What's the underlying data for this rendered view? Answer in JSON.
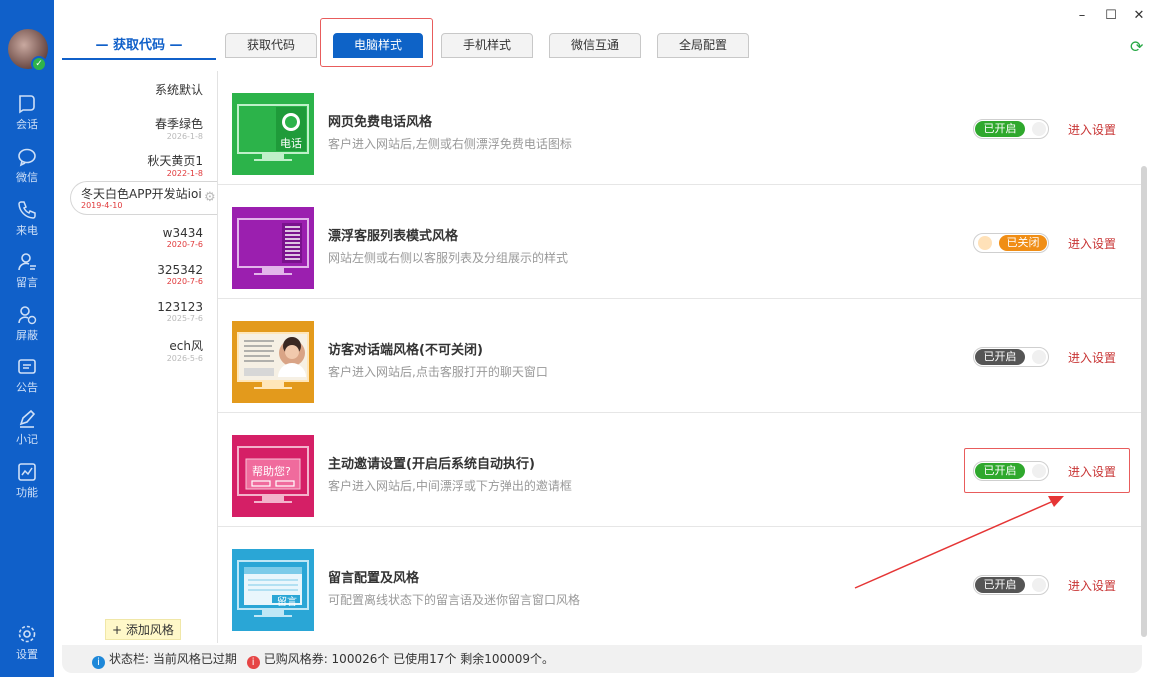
{
  "rail": {
    "items": [
      {
        "label": "会话",
        "icon": "chat-bubble-icon"
      },
      {
        "label": "微信",
        "icon": "wechat-icon"
      },
      {
        "label": "来电",
        "icon": "phone-icon"
      },
      {
        "label": "留言",
        "icon": "user-message-icon"
      },
      {
        "label": "屏蔽",
        "icon": "block-user-icon"
      },
      {
        "label": "公告",
        "icon": "announcement-icon"
      },
      {
        "label": "小记",
        "icon": "pen-icon"
      },
      {
        "label": "功能",
        "icon": "chart-icon"
      }
    ],
    "settings_label": "设置"
  },
  "col2": {
    "title": "— 获取代码 —",
    "styles": [
      {
        "name": "系统默认",
        "date": ""
      },
      {
        "name": "春季绿色",
        "date": "2026-1-8"
      },
      {
        "name": "秋天黄页1",
        "date": "2022-1-8"
      },
      {
        "name": "冬天白色APP开发站ioi",
        "date": "2019-4-10"
      },
      {
        "name": "w3434",
        "date": "2020-7-6"
      },
      {
        "name": "325342",
        "date": "2020-7-6"
      },
      {
        "name": "123123",
        "date": "2025-7-6"
      },
      {
        "name": "ech风",
        "date": "2026-5-6"
      }
    ],
    "add_label": "+ 添加风格"
  },
  "tabs": [
    {
      "label": "获取代码"
    },
    {
      "label": "电脑样式"
    },
    {
      "label": "手机样式"
    },
    {
      "label": "微信互通"
    },
    {
      "label": "全局配置"
    }
  ],
  "rows": [
    {
      "title": "网页免费电话风格",
      "desc": "客户进入网站后,左侧或右侧漂浮免费电话图标",
      "toggle": "已开启",
      "state": "on",
      "enter": "进入设置",
      "thumb_text": "电话"
    },
    {
      "title": "漂浮客服列表模式风格",
      "desc": "网站左侧或右侧以客服列表及分组展示的样式",
      "toggle": "已关闭",
      "state": "off",
      "enter": "进入设置",
      "thumb_text": ""
    },
    {
      "title": "访客对话端风格(不可关闭)",
      "desc": "客户进入网站后,点击客服打开的聊天窗口",
      "toggle": "已开启",
      "state": "dark",
      "enter": "进入设置",
      "thumb_text": ""
    },
    {
      "title": "主动邀请设置(开启后系统自动执行)",
      "desc": "客户进入网站后,中间漂浮或下方弹出的邀请框",
      "toggle": "已开启",
      "state": "on",
      "enter": "进入设置",
      "thumb_text": "帮助您?"
    },
    {
      "title": "留言配置及风格",
      "desc": "可配置离线状态下的留言语及迷你留言窗口风格",
      "toggle": "已开启",
      "state": "dark",
      "enter": "进入设置",
      "thumb_text": "留言"
    }
  ],
  "status": {
    "label1": "状态栏: 当前风格已过期",
    "label2": "已购风格券: 100026个 已使用17个 剩余100009个。"
  },
  "colors": {
    "brand": "#1060c9",
    "on": "#2fa82d",
    "off": "#f08e16",
    "link": "#c83535"
  }
}
